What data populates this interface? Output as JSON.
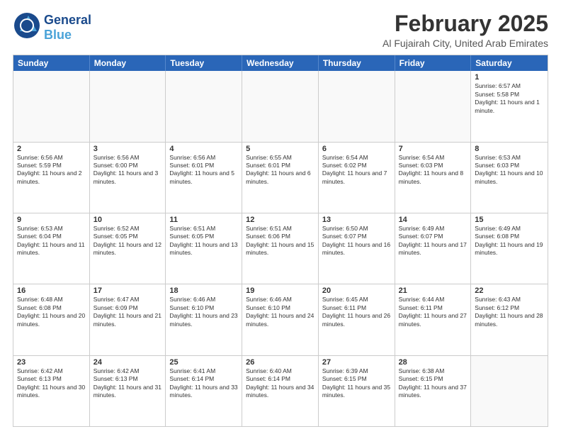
{
  "header": {
    "logo_line1": "General",
    "logo_line2": "Blue",
    "month": "February 2025",
    "location": "Al Fujairah City, United Arab Emirates"
  },
  "calendar": {
    "days": [
      "Sunday",
      "Monday",
      "Tuesday",
      "Wednesday",
      "Thursday",
      "Friday",
      "Saturday"
    ],
    "rows": [
      [
        {
          "day": "",
          "text": ""
        },
        {
          "day": "",
          "text": ""
        },
        {
          "day": "",
          "text": ""
        },
        {
          "day": "",
          "text": ""
        },
        {
          "day": "",
          "text": ""
        },
        {
          "day": "",
          "text": ""
        },
        {
          "day": "1",
          "text": "Sunrise: 6:57 AM\nSunset: 5:58 PM\nDaylight: 11 hours and 1 minute."
        }
      ],
      [
        {
          "day": "2",
          "text": "Sunrise: 6:56 AM\nSunset: 5:59 PM\nDaylight: 11 hours and 2 minutes."
        },
        {
          "day": "3",
          "text": "Sunrise: 6:56 AM\nSunset: 6:00 PM\nDaylight: 11 hours and 3 minutes."
        },
        {
          "day": "4",
          "text": "Sunrise: 6:56 AM\nSunset: 6:01 PM\nDaylight: 11 hours and 5 minutes."
        },
        {
          "day": "5",
          "text": "Sunrise: 6:55 AM\nSunset: 6:01 PM\nDaylight: 11 hours and 6 minutes."
        },
        {
          "day": "6",
          "text": "Sunrise: 6:54 AM\nSunset: 6:02 PM\nDaylight: 11 hours and 7 minutes."
        },
        {
          "day": "7",
          "text": "Sunrise: 6:54 AM\nSunset: 6:03 PM\nDaylight: 11 hours and 8 minutes."
        },
        {
          "day": "8",
          "text": "Sunrise: 6:53 AM\nSunset: 6:03 PM\nDaylight: 11 hours and 10 minutes."
        }
      ],
      [
        {
          "day": "9",
          "text": "Sunrise: 6:53 AM\nSunset: 6:04 PM\nDaylight: 11 hours and 11 minutes."
        },
        {
          "day": "10",
          "text": "Sunrise: 6:52 AM\nSunset: 6:05 PM\nDaylight: 11 hours and 12 minutes."
        },
        {
          "day": "11",
          "text": "Sunrise: 6:51 AM\nSunset: 6:05 PM\nDaylight: 11 hours and 13 minutes."
        },
        {
          "day": "12",
          "text": "Sunrise: 6:51 AM\nSunset: 6:06 PM\nDaylight: 11 hours and 15 minutes."
        },
        {
          "day": "13",
          "text": "Sunrise: 6:50 AM\nSunset: 6:07 PM\nDaylight: 11 hours and 16 minutes."
        },
        {
          "day": "14",
          "text": "Sunrise: 6:49 AM\nSunset: 6:07 PM\nDaylight: 11 hours and 17 minutes."
        },
        {
          "day": "15",
          "text": "Sunrise: 6:49 AM\nSunset: 6:08 PM\nDaylight: 11 hours and 19 minutes."
        }
      ],
      [
        {
          "day": "16",
          "text": "Sunrise: 6:48 AM\nSunset: 6:08 PM\nDaylight: 11 hours and 20 minutes."
        },
        {
          "day": "17",
          "text": "Sunrise: 6:47 AM\nSunset: 6:09 PM\nDaylight: 11 hours and 21 minutes."
        },
        {
          "day": "18",
          "text": "Sunrise: 6:46 AM\nSunset: 6:10 PM\nDaylight: 11 hours and 23 minutes."
        },
        {
          "day": "19",
          "text": "Sunrise: 6:46 AM\nSunset: 6:10 PM\nDaylight: 11 hours and 24 minutes."
        },
        {
          "day": "20",
          "text": "Sunrise: 6:45 AM\nSunset: 6:11 PM\nDaylight: 11 hours and 26 minutes."
        },
        {
          "day": "21",
          "text": "Sunrise: 6:44 AM\nSunset: 6:11 PM\nDaylight: 11 hours and 27 minutes."
        },
        {
          "day": "22",
          "text": "Sunrise: 6:43 AM\nSunset: 6:12 PM\nDaylight: 11 hours and 28 minutes."
        }
      ],
      [
        {
          "day": "23",
          "text": "Sunrise: 6:42 AM\nSunset: 6:13 PM\nDaylight: 11 hours and 30 minutes."
        },
        {
          "day": "24",
          "text": "Sunrise: 6:42 AM\nSunset: 6:13 PM\nDaylight: 11 hours and 31 minutes."
        },
        {
          "day": "25",
          "text": "Sunrise: 6:41 AM\nSunset: 6:14 PM\nDaylight: 11 hours and 33 minutes."
        },
        {
          "day": "26",
          "text": "Sunrise: 6:40 AM\nSunset: 6:14 PM\nDaylight: 11 hours and 34 minutes."
        },
        {
          "day": "27",
          "text": "Sunrise: 6:39 AM\nSunset: 6:15 PM\nDaylight: 11 hours and 35 minutes."
        },
        {
          "day": "28",
          "text": "Sunrise: 6:38 AM\nSunset: 6:15 PM\nDaylight: 11 hours and 37 minutes."
        },
        {
          "day": "",
          "text": ""
        }
      ]
    ]
  }
}
